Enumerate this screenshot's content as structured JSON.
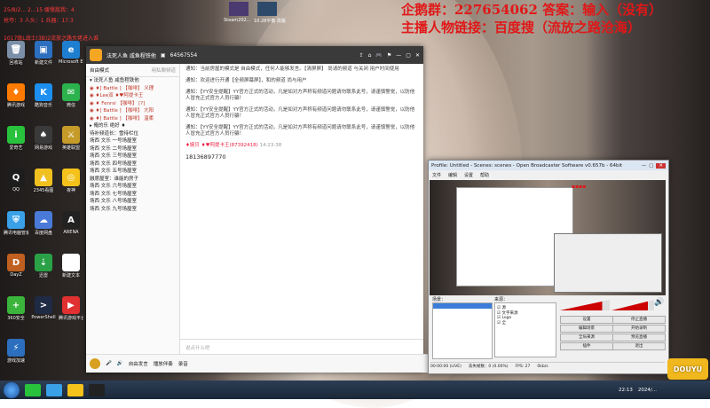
{
  "overlay": {
    "line1": "企鹅群：227654062 答案：输入（没有）",
    "line2": "主播人物链接：百度搜（流放之路沧海）"
  },
  "top_left": {
    "line1": "25/8/2... 2...15 缓慢敌我：4",
    "line2": "抢夺：3 人头：1 兵器：17.3",
    "line3": "1017级L战士(3B)2流放之路大佬进入谁"
  },
  "desktop_icons": [
    {
      "label": "回收站",
      "glyph": "🗑",
      "color": "#7b8fa8"
    },
    {
      "label": "新建文件",
      "glyph": "▣",
      "color": "#2c6fbf"
    },
    {
      "label": "Microsoft Edge",
      "glyph": "e",
      "color": "#1e7fd0"
    },
    {
      "label": "腾讯游戏",
      "glyph": "♦",
      "color": "#ff7a00"
    },
    {
      "label": "酷狗音乐",
      "glyph": "K",
      "color": "#1c8ff0"
    },
    {
      "label": "微信",
      "glyph": "✉",
      "color": "#2bb24c"
    },
    {
      "label": "爱奇艺",
      "glyph": "i",
      "color": "#28c23c"
    },
    {
      "label": "网易游戏",
      "glyph": "♠",
      "color": "#3a3a3a"
    },
    {
      "label": "英雄联盟",
      "glyph": "⚔",
      "color": "#c69b2a"
    },
    {
      "label": "QQ",
      "glyph": "Q",
      "color": "#1d1d1d"
    },
    {
      "label": "2345看图",
      "glyph": "▲",
      "color": "#f0c020"
    },
    {
      "label": "夜神",
      "glyph": "◎",
      "color": "#f4c21b"
    },
    {
      "label": "腾讯电脑管家",
      "glyph": "⛨",
      "color": "#3aa0e8"
    },
    {
      "label": "百度网盘",
      "glyph": "☁",
      "color": "#4a7ad8"
    },
    {
      "label": "ARENA",
      "glyph": "A",
      "color": "#222222"
    },
    {
      "label": "DayZ",
      "glyph": "D",
      "color": "#c06020"
    },
    {
      "label": "迅雷",
      "glyph": "⇣",
      "color": "#2aa146"
    },
    {
      "label": "新建文本",
      "glyph": "≡",
      "color": "#ffffff"
    },
    {
      "label": "360安全",
      "glyph": "+",
      "color": "#3ab43a"
    },
    {
      "label": "PowerShell",
      "glyph": ">",
      "color": "#1f2a44"
    },
    {
      "label": "腾讯游戏平台",
      "glyph": "▶",
      "color": "#e03030"
    },
    {
      "label": "游戏加速",
      "glyph": "⚡",
      "color": "#2c6fbf"
    }
  ],
  "top_bar_thumbs": [
    {
      "label": "Steam202...",
      "color": "#4b3a70"
    },
    {
      "label": "10.28平衡 改版",
      "color": "#2e4a6b"
    }
  ],
  "yy": {
    "channel": "法死人鱼 咸鱼程铁他",
    "room_id": "64567554",
    "left_header": "自由模式",
    "left_search": "用私聊频道",
    "left_rows": [
      "▾ 法死人鱼 咸鱼程铁他",
      "  ◉ ♦[ Battle ] 【咖啡】 义理",
      "  ◉ ♦Lee双 ♦♥阿提卡王",
      "  ◉ ♦ Fenrsi 【咖啡】 [?]",
      "  ◉ ♦[ Battle ] 【咖啡】 亢阳",
      "  ◉ ♦[ Battle ] 【咖啡】 温柔",
      "  ▸ 俺的乐 绝好 ♦",
      "  待补频道长：雪待栏位",
      "  场西 文乐 一号场屋室",
      "  场西 文乐 二号场屋室",
      "  场西 文乐 三号场屋室",
      "  场西 文乐 四号场屋室",
      "  场西 文乐 五号场屋室",
      "  融席屋室：谁能的房子",
      "  场西 文乐 六号场屋室",
      "  场西 文乐 七号场屋室",
      "  场西 文乐 八号场屋室",
      "  场西 文乐 九号场屋室"
    ],
    "notices": [
      "通知：当前房屋的模式是 自由模式，任何人能够发言。【清屏屏】 尚请的频道 与关闭 用户时间使用",
      "通知：欢迎进行开通【全频屏幕屏】，和的频道 尚与用户",
      "通知：【YY安全提醒】YY官方正式的活动，凡是如对方声称有频道问题请勿联系此号，请谨慎警觉，以防他人冒充正式官方人员行骗！",
      "通知：【YY安全提醒】YY官方正式的活动，凡是如对方声称有频道问题请勿联系此号，请谨慎警觉，以防他人冒充正式官方人员行骗！",
      "通知：【YY安全提醒】YY官方正式的活动，凡是如对方声称有频道问题请勿联系此号，请谨慎警觉，以防他人冒充正式官方人员行骗！"
    ],
    "chat_user": "♦婉贝 ♦♥阿提卡王(87392418)",
    "chat_time": "14:23:38",
    "chat_message": "18136897770",
    "input_placeholder": "说点什么吧",
    "bottom_items": [
      "自由发言",
      "播放伴奏",
      "录音"
    ]
  },
  "obs": {
    "title": "Profile: Untitled - Scenes: scenes - Open Broadcaster Software v0.657b - 64bit",
    "menu": [
      "文件",
      "编辑",
      "设置",
      "帮助"
    ],
    "scenes_label": "场景：",
    "sources_label": "来源：",
    "sources": [
      "源",
      "文字来源",
      "Logo",
      "全"
    ],
    "buttons": [
      "设置",
      "停止直播",
      "编辑场景",
      "开始录制",
      "全局来源",
      "预览直播",
      "插件",
      "退出"
    ],
    "status_left": "00:00:00 (LIVE)",
    "status_mid": "丢失帧数：0 (0.00%)",
    "status_fps": "FPS: 27",
    "status_rate": "0kb/s"
  },
  "tray": {
    "time": "22:13",
    "date": "2024/..."
  },
  "watermark": "DOUYU"
}
